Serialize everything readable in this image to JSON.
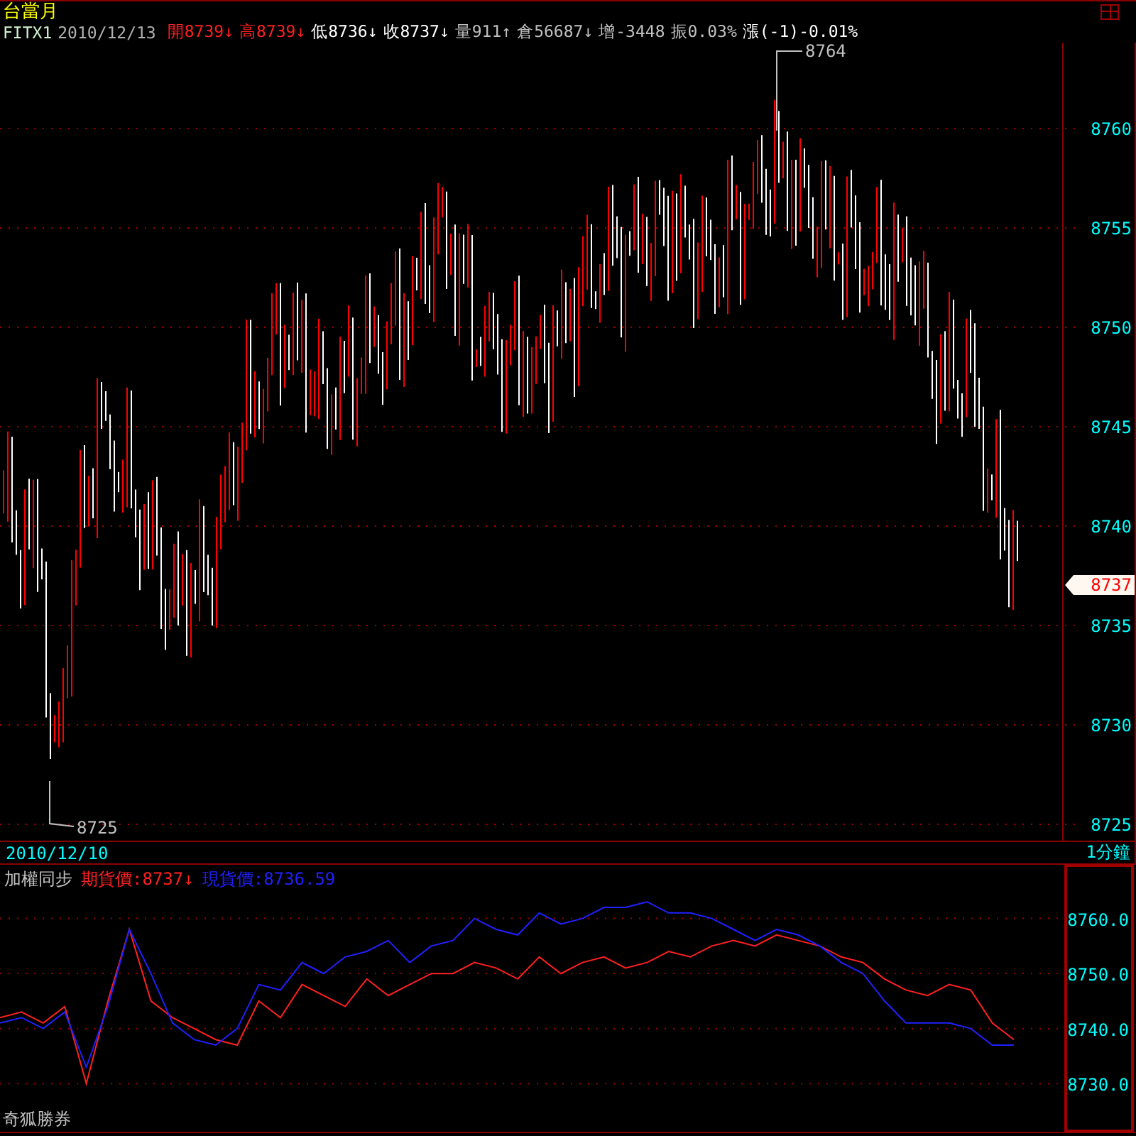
{
  "symbol": {
    "name": "台當月",
    "code": "FITX1",
    "date": "2010/12/13"
  },
  "quote": [
    {
      "text": "開8739↓",
      "color": "#ff2020"
    },
    {
      "text": "高8739↓",
      "color": "#ff2020"
    },
    {
      "text": "低8736↓",
      "color": "#ffffff"
    },
    {
      "text": "收8737↓",
      "color": "#ffffff"
    },
    {
      "text": "量911↑",
      "color": "#c0c0c0"
    },
    {
      "text": "倉56687↓",
      "color": "#c0c0c0"
    },
    {
      "text": "增-3448",
      "color": "#c0c0c0"
    },
    {
      "text": "振0.03%",
      "color": "#c0c0c0"
    },
    {
      "text": "漲(-1)-0.01%",
      "color": "#ffffff"
    }
  ],
  "main_chart": {
    "high_label": "8764",
    "low_label": "8725",
    "price_ticks": [
      "8760",
      "8755",
      "8750",
      "8745",
      "8740",
      "8735",
      "8730",
      "8725"
    ],
    "last_price": "8737"
  },
  "date_bar": {
    "date": "2010/12/10",
    "interval": "1分鐘"
  },
  "sync_chart": {
    "title": "加權同步",
    "futures_value": ":8737↓",
    "spot_value": ":8736.59",
    "chart_data": {
      "type": "line",
      "grid": true,
      "ylim": [
        8721,
        8770
      ],
      "yticks": [
        {
          "value": 8760,
          "label": "8760.0"
        },
        {
          "value": 8750,
          "label": "8750.0"
        },
        {
          "value": 8740,
          "label": "8740.0"
        },
        {
          "value": 8730,
          "label": "8730.0"
        }
      ],
      "series": [
        {
          "name": "期貨價",
          "color": "#ff2020",
          "values": [
            8742,
            8743,
            8741,
            8744,
            8730,
            8745,
            8758,
            8745,
            8742,
            8740,
            8738,
            8737,
            8745,
            8742,
            8748,
            8746,
            8744,
            8749,
            8746,
            8748,
            8750,
            8750,
            8752,
            8751,
            8749,
            8753,
            8750,
            8752,
            8753,
            8751,
            8752,
            8754,
            8753,
            8755,
            8756,
            8755,
            8757,
            8756,
            8755,
            8753,
            8752,
            8749,
            8747,
            8746,
            8748,
            8747,
            8741,
            8738
          ]
        },
        {
          "name": "現貨價",
          "color": "#2020ff",
          "values": [
            8741,
            8742,
            8740,
            8743,
            8733,
            8744,
            8758,
            8750,
            8741,
            8738,
            8737,
            8740,
            8748,
            8747,
            8752,
            8750,
            8753,
            8754,
            8756,
            8752,
            8755,
            8756,
            8760,
            8758,
            8757,
            8761,
            8759,
            8760,
            8762,
            8762,
            8763,
            8761,
            8761,
            8760,
            8758,
            8756,
            8758,
            8757,
            8755,
            8752,
            8750,
            8745,
            8741,
            8741,
            8741,
            8740,
            8737,
            8737
          ]
        }
      ]
    }
  },
  "footer_label": "奇狐勝券"
}
